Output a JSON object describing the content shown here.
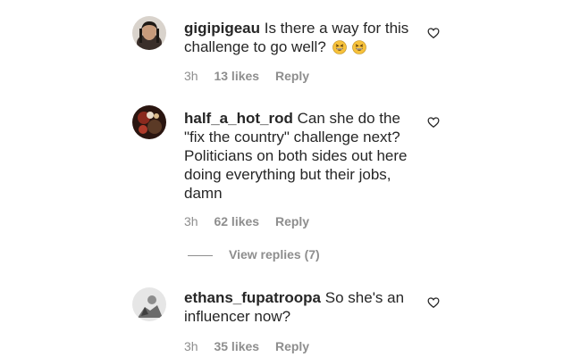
{
  "comments": [
    {
      "username": "gigipigeau",
      "text": "Is there a way for this challenge to go well?",
      "emojis": [
        "grinning-squinting-face",
        "grinning-squinting-face"
      ],
      "time": "3h",
      "likes": "13 likes",
      "reply": "Reply"
    },
    {
      "username": "half_a_hot_rod",
      "text": "Can she do the \"fix the country\" challenge next? Politicians on both sides out here doing everything but their jobs, damn",
      "time": "3h",
      "likes": "62 likes",
      "reply": "Reply",
      "view_replies": "View replies (7)"
    },
    {
      "username": "ethans_fupatroopa",
      "text": "So she's an influencer now?",
      "time": "3h",
      "likes": "35 likes",
      "reply": "Reply"
    }
  ],
  "colors": {
    "text": "#262626",
    "secondary": "#8e8e8e",
    "emoji_yellow": "#f7c23b"
  }
}
